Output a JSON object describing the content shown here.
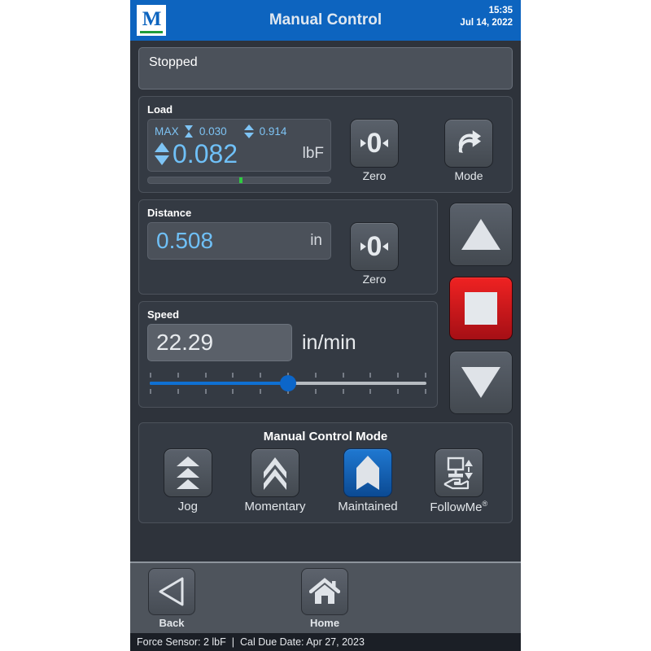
{
  "header": {
    "title": "Manual Control",
    "logo_letter": "M",
    "time": "15:35",
    "date": "Jul 14, 2022"
  },
  "status_banner": {
    "text": "Stopped"
  },
  "load": {
    "label": "Load",
    "max_label": "MAX",
    "min_peak_value": "0.030",
    "max_peak_value": "0.914",
    "value": "0.082",
    "unit": "lbF",
    "bar_percent": 50,
    "bar_color": "#2ecc40",
    "zero_button": "Zero",
    "mode_button": "Mode"
  },
  "distance": {
    "label": "Distance",
    "value": "0.508",
    "unit": "in",
    "zero_button": "Zero"
  },
  "speed": {
    "label": "Speed",
    "value": "22.29",
    "unit": "in/min",
    "slider_percent": 50,
    "tick_count": 11
  },
  "jog_controls": {
    "up_label": "up-arrow",
    "stop_label": "stop",
    "down_label": "down-arrow"
  },
  "manual_mode": {
    "title": "Manual Control Mode",
    "selected": "Maintained",
    "items": [
      {
        "label": "Jog",
        "icon": "triple-chevron-up-icon",
        "selected": false
      },
      {
        "label": "Momentary",
        "icon": "double-chevron-up-icon",
        "selected": false
      },
      {
        "label": "Maintained",
        "icon": "bookmark-arrow-up-icon",
        "selected": true
      },
      {
        "label": "FollowMe",
        "icon": "hand-fixture-icon",
        "selected": false,
        "sup": "®"
      }
    ]
  },
  "footer": {
    "back_label": "Back",
    "home_label": "Home"
  },
  "statusbar": {
    "sensor": "Force Sensor: 2 lbF",
    "separator": "|",
    "cal": "Cal Due Date: Apr 27, 2023"
  },
  "colors": {
    "header_blue": "#0d64bf",
    "accent_blue": "#6fc0f7",
    "stop_red": "#ef2222",
    "ok_green": "#1f9d3a"
  }
}
